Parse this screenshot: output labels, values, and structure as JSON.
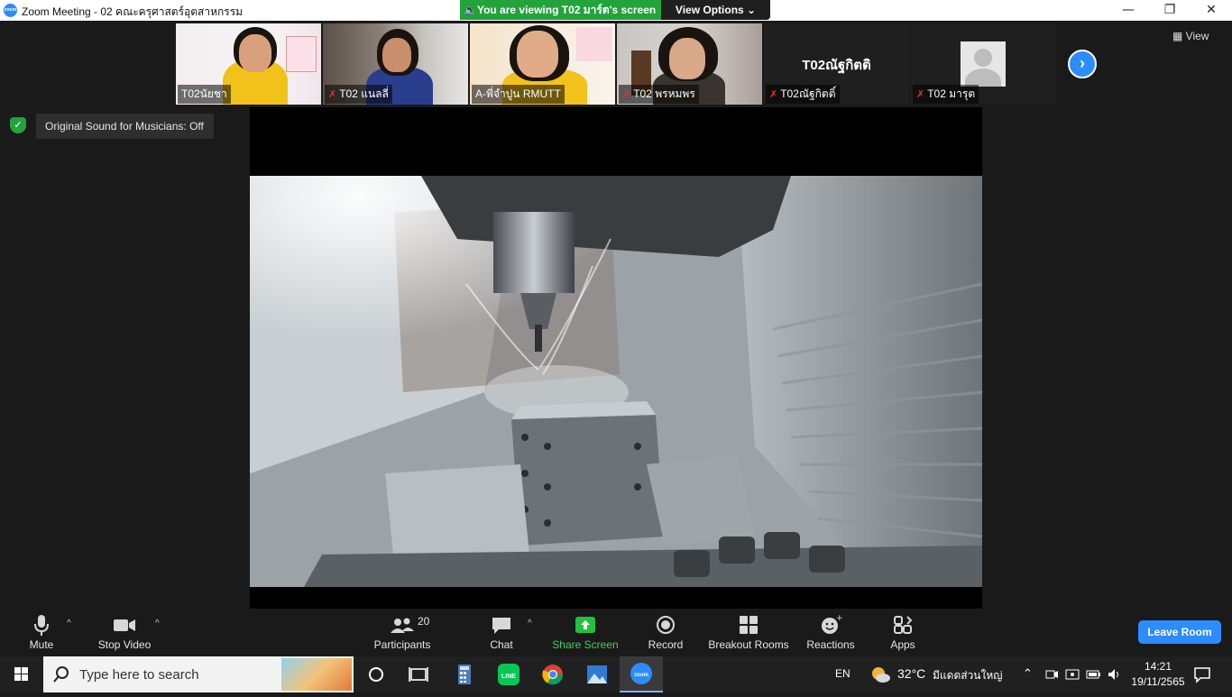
{
  "window": {
    "title": "Zoom Meeting - 02 คณะครุศาสตร์อุตสาหกรรม",
    "minimize": "—",
    "restore": "❐",
    "close": "✕"
  },
  "share_banner": {
    "text": "You are viewing T02 มาร์ต's screen",
    "view_options": "View Options ⌄"
  },
  "gallery": {
    "view_label": "View",
    "participants": [
      {
        "name": "T02นัยชา",
        "muted": false
      },
      {
        "name": "T02 แนลลี่",
        "muted": true
      },
      {
        "name": "A-พี่จำปูน RMUTT",
        "muted": false
      },
      {
        "name": "T02 พรหมพร",
        "muted": true
      },
      {
        "name": "T02ณัฐกิตติ์",
        "muted": true,
        "display_name": "T02ณัฐกิตติ"
      },
      {
        "name": "T02 มารุต",
        "muted": true
      }
    ],
    "mute_symbol": "✗"
  },
  "sound_status": "Original Sound for Musicians: Off",
  "controls": {
    "mute": "Mute",
    "stop_video": "Stop Video",
    "participants": "Participants",
    "participant_count": "20",
    "chat": "Chat",
    "share_screen": "Share Screen",
    "record": "Record",
    "breakout_rooms": "Breakout Rooms",
    "reactions": "Reactions",
    "apps": "Apps",
    "leave_room": "Leave Room",
    "caret": "^"
  },
  "taskbar": {
    "search_placeholder": "Type here to search",
    "language": "EN",
    "temperature": "32°C",
    "weather": "มีแดดส่วนใหญ่",
    "time": "14:21",
    "date": "19/11/2565"
  },
  "colors": {
    "zoom_blue": "#2d8cff",
    "share_green": "#23a33b",
    "mute_red": "#e03232"
  }
}
